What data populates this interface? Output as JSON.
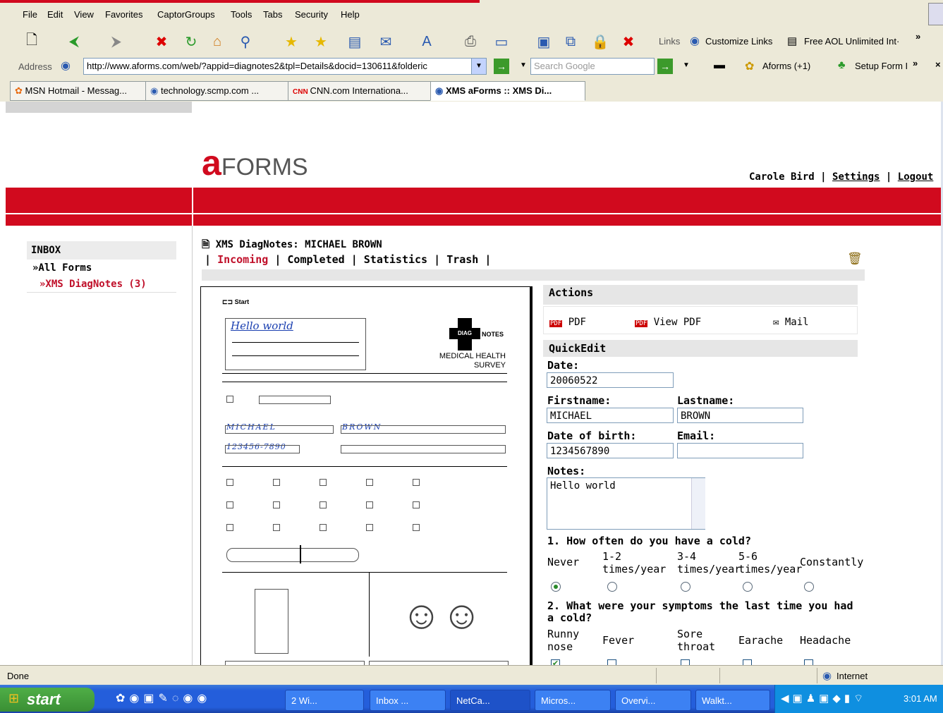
{
  "browser": {
    "menu": [
      "File",
      "Edit",
      "View",
      "Favorites",
      "CaptorGroups",
      "Tools",
      "Tabs",
      "Security",
      "Help"
    ],
    "toolbar_links": {
      "links": "Links",
      "customize": "Customize Links",
      "aol": "Free AOL Unlimited Int·"
    },
    "address_label": "Address",
    "address_url": "http://www.aforms.com/web/?appid=diagnotes2&tpl=Details&docid=130611&folderic",
    "search_placeholder": "Search Google",
    "aforms_button": "Aforms (+1)",
    "setup_form": "Setup Form I",
    "tabs": [
      {
        "label": "MSN Hotmail - Messag..."
      },
      {
        "label": "technology.scmp.com ..."
      },
      {
        "label": "CNN.com Internationa..."
      },
      {
        "label": "XMS aForms :: XMS Di..."
      }
    ],
    "status_text": "Done",
    "zone": "Internet"
  },
  "page": {
    "logo_a": "a",
    "logo_text": "FORMS",
    "user": "Carole Bird",
    "separator": "|",
    "settings": "Settings",
    "logout": "Logout",
    "sidebar": {
      "title": "INBOX",
      "all_forms": "»All Forms",
      "diagnotes": "»XMS DiagNotes (3)"
    },
    "doc_title": "XMS DiagNotes: MICHAEL BROWN",
    "folder_tabs": [
      "Incoming",
      "Completed",
      "Statistics",
      "Trash"
    ],
    "actions": {
      "title": "Actions",
      "pdf": "PDF",
      "view_pdf": "View PDF",
      "mail": "Mail"
    },
    "quickedit": {
      "title": "QuickEdit",
      "date_label": "Date:",
      "date": "20060522",
      "firstname_label": "Firstname:",
      "firstname": "MICHAEL",
      "lastname_label": "Lastname:",
      "lastname": "BROWN",
      "dob_label": "Date of birth:",
      "dob": "1234567890",
      "email_label": "Email:",
      "email": "",
      "notes_label": "Notes:",
      "notes": "Hello world",
      "q1": "1. How often do you have a cold?",
      "q1_options": [
        "Never",
        "1-2 times/year",
        "3-4 times/year",
        "5-6 times/year",
        "Constantly"
      ],
      "q1_selected": 0,
      "q2": "2. What were your symptoms the last time you had a cold?",
      "q2_options": [
        "Runny nose",
        "Fever",
        "Sore throat",
        "Earache",
        "Headache"
      ]
    },
    "scan": {
      "handwritten_name": "Hello world",
      "logo_diag": "DIAG",
      "logo_notes": "NOTES",
      "survey_title_1": "MEDICAL HEALTH",
      "survey_title_2": "SURVEY",
      "first_name": "MICHAEL",
      "last_name": "BROWN",
      "dob": "123456-7890"
    }
  },
  "taskbar": {
    "start": "start",
    "tasks": [
      "2 Wi...",
      "Inbox ...",
      "NetCa...",
      "Micros...",
      "Overvi...",
      "Walkt..."
    ],
    "clock": "3:01 AM"
  },
  "colors": {
    "brand_red": "#d10a1e",
    "link_red": "#c0102a"
  }
}
